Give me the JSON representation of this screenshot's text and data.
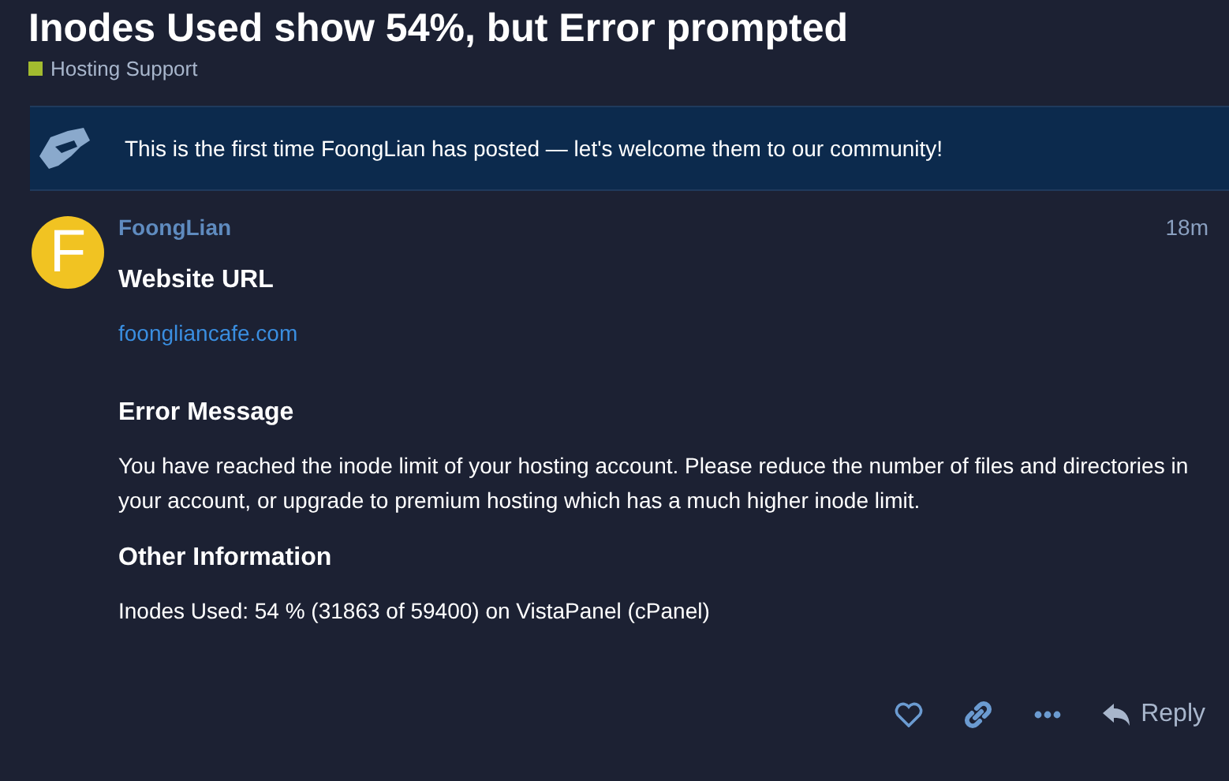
{
  "topic": {
    "title": "Inodes Used show 54%, but Error prompted",
    "category": {
      "name": "Hosting Support",
      "color": "#a2bb2f"
    }
  },
  "notice": {
    "text": "This is the first time FoongLian has posted — let's welcome them to our community!"
  },
  "post": {
    "avatar_letter": "F",
    "username": "FoongLian",
    "time": "18m",
    "sections": [
      {
        "heading": "Website URL",
        "kind": "link",
        "body": "foongliancafe.com"
      },
      {
        "heading": "Error Message",
        "kind": "text",
        "body": "You have reached the inode limit of your hosting account. Please reduce the number of files and directories in your account, or upgrade to premium hosting which has a much higher inode limit."
      },
      {
        "heading": "Other Information",
        "kind": "text",
        "body": "Inodes Used: 54 % (31863 of 59400) on VistaPanel (cPanel)"
      }
    ],
    "reply_label": "Reply"
  }
}
